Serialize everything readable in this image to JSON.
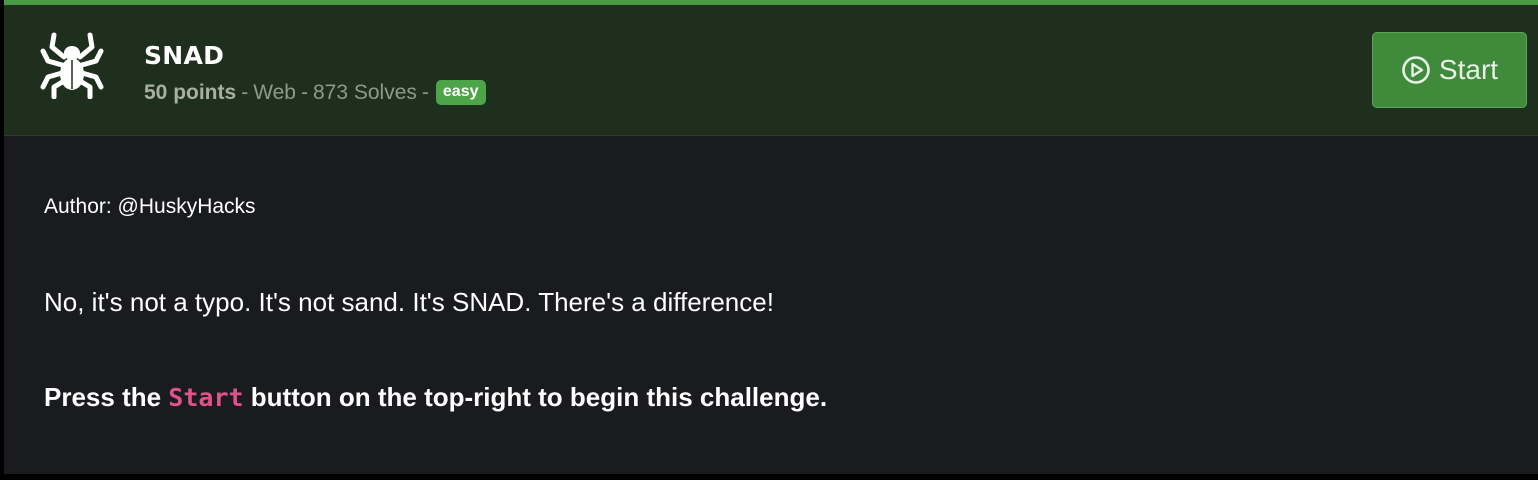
{
  "challenge": {
    "title": "SNAD",
    "points": "50 points",
    "category": "Web",
    "solves": "873 Solves",
    "difficulty": "easy",
    "icon": "spider-icon"
  },
  "actions": {
    "start_label": "Start"
  },
  "body": {
    "author": "Author: @HuskyHacks",
    "description": "No, it's not a typo. It's not sand. It's SNAD. There's a difference!",
    "instruction_prefix": "Press the ",
    "instruction_code": "Start",
    "instruction_suffix": " button on the top-right to begin this challenge."
  },
  "colors": {
    "accent": "#4a9a45",
    "header_bg": "#1e301d",
    "body_bg": "#1a1b1e",
    "code": "#e0518e"
  }
}
